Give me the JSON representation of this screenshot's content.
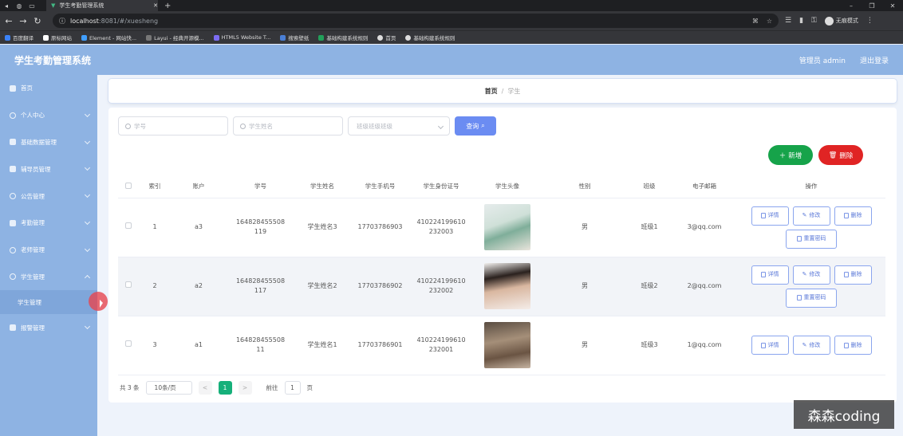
{
  "browser": {
    "tab_title": "学生考勤管理系统",
    "url_host": "localhost",
    "url_path": ":8081/#/xuesheng",
    "incognito_label": "无痕模式",
    "bookmarks": [
      "百度翻译",
      "原标网站",
      "Element - 网站快...",
      "Layui - 经典开源模...",
      "HTML5 Website T...",
      "搜索壁纸",
      "基础构建系统规则",
      "首页",
      "基础构建系统规则"
    ]
  },
  "header": {
    "title": "学生考勤管理系统",
    "user_label": "管理员 admin",
    "logout_label": "退出登录"
  },
  "sidebar": {
    "items": [
      {
        "label": "首页"
      },
      {
        "label": "个人中心"
      },
      {
        "label": "基础数据管理"
      },
      {
        "label": "辅导员管理"
      },
      {
        "label": "公告管理"
      },
      {
        "label": "考勤管理"
      },
      {
        "label": "老师管理"
      },
      {
        "label": "学生管理"
      },
      {
        "label": "学生管理"
      },
      {
        "label": "报警管理"
      }
    ]
  },
  "breadcrumb": {
    "home": "首页",
    "separator": "/",
    "current": "学生"
  },
  "search": {
    "student_no_placeholder": "学号",
    "student_name_placeholder": "学生姓名",
    "class_placeholder": "班级班级班级",
    "query_label": "查询"
  },
  "actions": {
    "add_label": "新增",
    "delete_label": "删除"
  },
  "table": {
    "columns": [
      "索引",
      "账户",
      "学号",
      "学生姓名",
      "学生手机号",
      "学生身份证号",
      "学生头像",
      "性别",
      "班级",
      "电子邮箱",
      "操作"
    ],
    "rows": [
      {
        "index": "1",
        "account": "a3",
        "student_no_1": "164828455508",
        "student_no_2": "119",
        "name": "学生姓名3",
        "phone": "17703786903",
        "idcard_1": "410224199610",
        "idcard_2": "232003",
        "gender": "男",
        "class": "班级1",
        "email": "3@qq.com"
      },
      {
        "index": "2",
        "account": "a2",
        "student_no_1": "164828455508",
        "student_no_2": "117",
        "name": "学生姓名2",
        "phone": "17703786902",
        "idcard_1": "410224199610",
        "idcard_2": "232002",
        "gender": "男",
        "class": "班级2",
        "email": "2@qq.com"
      },
      {
        "index": "3",
        "account": "a1",
        "student_no_1": "164828455508",
        "student_no_2": "11",
        "name": "学生姓名1",
        "phone": "17703786901",
        "idcard_1": "410224199610",
        "idcard_2": "232001",
        "gender": "男",
        "class": "班级3",
        "email": "1@qq.com"
      }
    ],
    "op_labels": {
      "detail": "详情",
      "edit": "修改",
      "delete": "删除",
      "reset": "重置密码"
    }
  },
  "pagination": {
    "total": "共 3 条",
    "page_size": "10条/页",
    "prev": "<",
    "current": "1",
    "next": ">",
    "goto_label": "前往",
    "goto_value": "1",
    "page_suffix": "页"
  },
  "watermark": "森森coding",
  "colors": {
    "sidebar": "#8eb3e3",
    "add": "#16a34a",
    "delete": "#e02424",
    "query": "#6b8cf2",
    "page_active": "#16b07a"
  }
}
